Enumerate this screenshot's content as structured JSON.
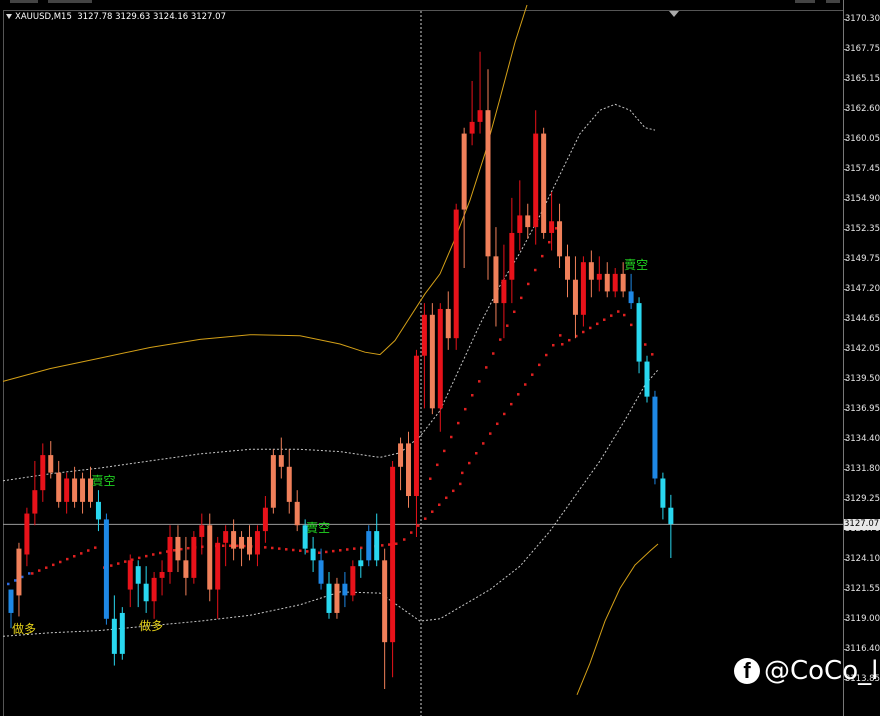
{
  "header": {
    "symbol": "XAUUSD,M15",
    "ohlc": "3127.78 3129.63 3124.16 3127.07"
  },
  "price_axis": {
    "labels": [
      "3170.30",
      "3167.75",
      "3165.15",
      "3162.60",
      "3160.05",
      "3157.45",
      "3154.90",
      "3152.35",
      "3149.75",
      "3147.20",
      "3144.65",
      "3142.05",
      "3139.50",
      "3136.95",
      "3134.40",
      "3131.80",
      "3129.25",
      "3126.70",
      "3124.10",
      "3121.55",
      "3119.00",
      "3116.40",
      "3113.85"
    ],
    "current_price": "3127.07"
  },
  "signals": {
    "sell_label": "賣空",
    "buy_label": "做多"
  },
  "watermark": {
    "icon": "facebook-icon",
    "text": "@CoCo_ll"
  },
  "colors": {
    "background": "#000000",
    "bull_candle": "#29d7ef",
    "bull_candle_dark": "#1e88e5",
    "bear_candle": "#e8121a",
    "bear_candle_light": "#f0805a",
    "upper_band": "#d4a017",
    "envelope": "#c8c8c8",
    "sar_dots": "#e02020",
    "sell_signal": "#21d421",
    "buy_signal": "#e6d21a"
  },
  "chart_data": {
    "type": "candlestick",
    "symbol": "XAUUSD",
    "timeframe": "M15",
    "ylim": [
      3112.5,
      3171.5
    ],
    "candles": [
      {
        "o": 3119.5,
        "h": 3121.0,
        "l": 3118.2,
        "c": 3121.5,
        "dir": "up"
      },
      {
        "o": 3121.0,
        "h": 3125.5,
        "l": 3119.2,
        "c": 3125.0,
        "dir": "down"
      },
      {
        "o": 3124.5,
        "h": 3128.5,
        "l": 3123.5,
        "c": 3128.0,
        "dir": "down"
      },
      {
        "o": 3128.0,
        "h": 3132.5,
        "l": 3127.0,
        "c": 3130.0,
        "dir": "down"
      },
      {
        "o": 3130.0,
        "h": 3134.0,
        "l": 3129.0,
        "c": 3133.0,
        "dir": "down"
      },
      {
        "o": 3133.0,
        "h": 3134.2,
        "l": 3131.0,
        "c": 3131.5,
        "dir": "down"
      },
      {
        "o": 3131.5,
        "h": 3132.5,
        "l": 3128.5,
        "c": 3129.0,
        "dir": "down"
      },
      {
        "o": 3129.0,
        "h": 3131.5,
        "l": 3128.0,
        "c": 3131.0,
        "dir": "down"
      },
      {
        "o": 3131.0,
        "h": 3132.0,
        "l": 3128.5,
        "c": 3129.0,
        "dir": "down"
      },
      {
        "o": 3129.0,
        "h": 3131.5,
        "l": 3128.0,
        "c": 3131.0,
        "dir": "down"
      },
      {
        "o": 3131.0,
        "h": 3132.0,
        "l": 3128.5,
        "c": 3129.0,
        "dir": "down"
      },
      {
        "o": 3129.0,
        "h": 3130.0,
        "l": 3126.5,
        "c": 3127.5,
        "dir": "up"
      },
      {
        "o": 3127.5,
        "h": 3128.0,
        "l": 3118.5,
        "c": 3119.0,
        "dir": "up"
      },
      {
        "o": 3119.0,
        "h": 3121.0,
        "l": 3115.0,
        "c": 3116.0,
        "dir": "up"
      },
      {
        "o": 3116.0,
        "h": 3120.0,
        "l": 3115.5,
        "c": 3119.5,
        "dir": "up"
      },
      {
        "o": 3121.5,
        "h": 3124.5,
        "l": 3120.0,
        "c": 3124.0,
        "dir": "down"
      },
      {
        "o": 3123.5,
        "h": 3124.0,
        "l": 3120.0,
        "c": 3122.0,
        "dir": "up"
      },
      {
        "o": 3122.0,
        "h": 3123.5,
        "l": 3119.5,
        "c": 3120.5,
        "dir": "up"
      },
      {
        "o": 3120.5,
        "h": 3123.0,
        "l": 3119.0,
        "c": 3122.5,
        "dir": "down"
      },
      {
        "o": 3122.5,
        "h": 3124.0,
        "l": 3121.0,
        "c": 3123.0,
        "dir": "down"
      },
      {
        "o": 3123.0,
        "h": 3127.0,
        "l": 3122.0,
        "c": 3126.0,
        "dir": "down"
      },
      {
        "o": 3126.0,
        "h": 3127.0,
        "l": 3123.0,
        "c": 3124.0,
        "dir": "down"
      },
      {
        "o": 3124.0,
        "h": 3126.0,
        "l": 3121.0,
        "c": 3122.5,
        "dir": "down"
      },
      {
        "o": 3122.5,
        "h": 3126.5,
        "l": 3122.0,
        "c": 3126.0,
        "dir": "down"
      },
      {
        "o": 3126.0,
        "h": 3128.0,
        "l": 3124.5,
        "c": 3127.0,
        "dir": "down"
      },
      {
        "o": 3127.0,
        "h": 3128.0,
        "l": 3120.5,
        "c": 3121.5,
        "dir": "down"
      },
      {
        "o": 3121.5,
        "h": 3126.0,
        "l": 3119.0,
        "c": 3125.5,
        "dir": "down"
      },
      {
        "o": 3125.5,
        "h": 3127.0,
        "l": 3123.5,
        "c": 3126.5,
        "dir": "down"
      },
      {
        "o": 3126.5,
        "h": 3127.5,
        "l": 3124.0,
        "c": 3125.0,
        "dir": "down"
      },
      {
        "o": 3125.0,
        "h": 3126.5,
        "l": 3123.5,
        "c": 3126.0,
        "dir": "down"
      },
      {
        "o": 3126.0,
        "h": 3127.0,
        "l": 3124.0,
        "c": 3124.5,
        "dir": "down"
      },
      {
        "o": 3124.5,
        "h": 3127.0,
        "l": 3123.5,
        "c": 3126.5,
        "dir": "down"
      },
      {
        "o": 3126.5,
        "h": 3129.5,
        "l": 3125.5,
        "c": 3128.5,
        "dir": "down"
      },
      {
        "o": 3128.5,
        "h": 3133.5,
        "l": 3128.0,
        "c": 3133.0,
        "dir": "down"
      },
      {
        "o": 3133.0,
        "h": 3134.5,
        "l": 3131.0,
        "c": 3132.0,
        "dir": "down"
      },
      {
        "o": 3132.0,
        "h": 3133.5,
        "l": 3128.0,
        "c": 3129.0,
        "dir": "down"
      },
      {
        "o": 3129.0,
        "h": 3130.0,
        "l": 3126.5,
        "c": 3127.0,
        "dir": "down"
      },
      {
        "o": 3127.0,
        "h": 3127.5,
        "l": 3124.5,
        "c": 3125.0,
        "dir": "up"
      },
      {
        "o": 3125.0,
        "h": 3126.0,
        "l": 3123.0,
        "c": 3124.0,
        "dir": "up"
      },
      {
        "o": 3124.0,
        "h": 3125.0,
        "l": 3121.5,
        "c": 3122.0,
        "dir": "up"
      },
      {
        "o": 3122.0,
        "h": 3123.0,
        "l": 3119.0,
        "c": 3119.5,
        "dir": "up"
      },
      {
        "o": 3119.5,
        "h": 3122.5,
        "l": 3119.0,
        "c": 3122.0,
        "dir": "down"
      },
      {
        "o": 3122.0,
        "h": 3123.0,
        "l": 3120.0,
        "c": 3121.0,
        "dir": "up"
      },
      {
        "o": 3121.0,
        "h": 3124.0,
        "l": 3120.5,
        "c": 3123.5,
        "dir": "down"
      },
      {
        "o": 3123.5,
        "h": 3125.0,
        "l": 3122.5,
        "c": 3124.0,
        "dir": "up"
      },
      {
        "o": 3124.0,
        "h": 3127.0,
        "l": 3123.5,
        "c": 3126.5,
        "dir": "up"
      },
      {
        "o": 3126.5,
        "h": 3128.0,
        "l": 3123.5,
        "c": 3124.0,
        "dir": "up"
      },
      {
        "o": 3124.0,
        "h": 3125.0,
        "l": 3113.0,
        "c": 3117.0,
        "dir": "down"
      },
      {
        "o": 3117.0,
        "h": 3132.5,
        "l": 3114.0,
        "c": 3132.0,
        "dir": "down"
      },
      {
        "o": 3132.0,
        "h": 3134.5,
        "l": 3130.0,
        "c": 3134.0,
        "dir": "down"
      },
      {
        "o": 3134.0,
        "h": 3135.0,
        "l": 3128.5,
        "c": 3129.5,
        "dir": "down"
      },
      {
        "o": 3129.5,
        "h": 3142.0,
        "l": 3126.0,
        "c": 3141.5,
        "dir": "down"
      },
      {
        "o": 3141.5,
        "h": 3146.0,
        "l": 3137.0,
        "c": 3145.0,
        "dir": "down"
      },
      {
        "o": 3145.0,
        "h": 3146.0,
        "l": 3136.5,
        "c": 3137.0,
        "dir": "down"
      },
      {
        "o": 3137.0,
        "h": 3146.0,
        "l": 3135.0,
        "c": 3145.5,
        "dir": "down"
      },
      {
        "o": 3145.5,
        "h": 3147.0,
        "l": 3142.0,
        "c": 3143.0,
        "dir": "down"
      },
      {
        "o": 3143.0,
        "h": 3154.5,
        "l": 3142.0,
        "c": 3154.0,
        "dir": "down"
      },
      {
        "o": 3154.0,
        "h": 3161.0,
        "l": 3149.0,
        "c": 3160.5,
        "dir": "down"
      },
      {
        "o": 3160.5,
        "h": 3165.0,
        "l": 3159.5,
        "c": 3161.5,
        "dir": "down"
      },
      {
        "o": 3161.5,
        "h": 3167.5,
        "l": 3160.5,
        "c": 3162.5,
        "dir": "down"
      },
      {
        "o": 3162.5,
        "h": 3166.0,
        "l": 3148.0,
        "c": 3150.0,
        "dir": "down"
      },
      {
        "o": 3150.0,
        "h": 3152.5,
        "l": 3144.0,
        "c": 3146.0,
        "dir": "down"
      },
      {
        "o": 3146.0,
        "h": 3151.0,
        "l": 3143.0,
        "c": 3148.0,
        "dir": "down"
      },
      {
        "o": 3148.0,
        "h": 3155.0,
        "l": 3146.0,
        "c": 3152.0,
        "dir": "down"
      },
      {
        "o": 3152.0,
        "h": 3156.5,
        "l": 3150.5,
        "c": 3153.5,
        "dir": "down"
      },
      {
        "o": 3153.5,
        "h": 3154.5,
        "l": 3151.5,
        "c": 3152.5,
        "dir": "down"
      },
      {
        "o": 3152.5,
        "h": 3162.5,
        "l": 3151.0,
        "c": 3160.5,
        "dir": "down"
      },
      {
        "o": 3160.5,
        "h": 3161.0,
        "l": 3151.5,
        "c": 3152.0,
        "dir": "down"
      },
      {
        "o": 3152.0,
        "h": 3155.5,
        "l": 3150.5,
        "c": 3153.0,
        "dir": "down"
      },
      {
        "o": 3153.0,
        "h": 3154.5,
        "l": 3149.0,
        "c": 3150.0,
        "dir": "down"
      },
      {
        "o": 3150.0,
        "h": 3151.0,
        "l": 3146.5,
        "c": 3148.0,
        "dir": "down"
      },
      {
        "o": 3148.0,
        "h": 3150.0,
        "l": 3143.0,
        "c": 3145.0,
        "dir": "down"
      },
      {
        "o": 3145.0,
        "h": 3150.0,
        "l": 3144.0,
        "c": 3149.5,
        "dir": "down"
      },
      {
        "o": 3149.5,
        "h": 3150.5,
        "l": 3146.5,
        "c": 3148.0,
        "dir": "down"
      },
      {
        "o": 3148.0,
        "h": 3150.0,
        "l": 3147.0,
        "c": 3148.5,
        "dir": "down"
      },
      {
        "o": 3148.5,
        "h": 3149.5,
        "l": 3146.5,
        "c": 3147.0,
        "dir": "down"
      },
      {
        "o": 3147.0,
        "h": 3149.0,
        "l": 3146.5,
        "c": 3148.5,
        "dir": "down"
      },
      {
        "o": 3148.5,
        "h": 3149.5,
        "l": 3146.5,
        "c": 3147.0,
        "dir": "down"
      },
      {
        "o": 3147.0,
        "h": 3148.5,
        "l": 3145.5,
        "c": 3146.0,
        "dir": "up"
      },
      {
        "o": 3146.0,
        "h": 3146.5,
        "l": 3140.0,
        "c": 3141.0,
        "dir": "up"
      },
      {
        "o": 3141.0,
        "h": 3141.5,
        "l": 3137.5,
        "c": 3138.0,
        "dir": "up"
      },
      {
        "o": 3138.0,
        "h": 3138.5,
        "l": 3130.5,
        "c": 3131.0,
        "dir": "up"
      },
      {
        "o": 3131.0,
        "h": 3131.5,
        "l": 3127.5,
        "c": 3128.5,
        "dir": "up"
      },
      {
        "o": 3128.5,
        "h": 3129.6,
        "l": 3124.2,
        "c": 3127.1,
        "dir": "up"
      }
    ],
    "signals": [
      {
        "label": "做多",
        "bar": 1
      },
      {
        "label": "賣空",
        "bar": 11
      },
      {
        "label": "做多",
        "bar": 17
      },
      {
        "label": "賣空",
        "bar": 38
      },
      {
        "label": "賣空",
        "bar": 78
      }
    ],
    "lines": [
      "upper_band",
      "upper_envelope",
      "lower_envelope",
      "lower_band",
      "sar_dots"
    ],
    "current_price": 3127.07
  }
}
